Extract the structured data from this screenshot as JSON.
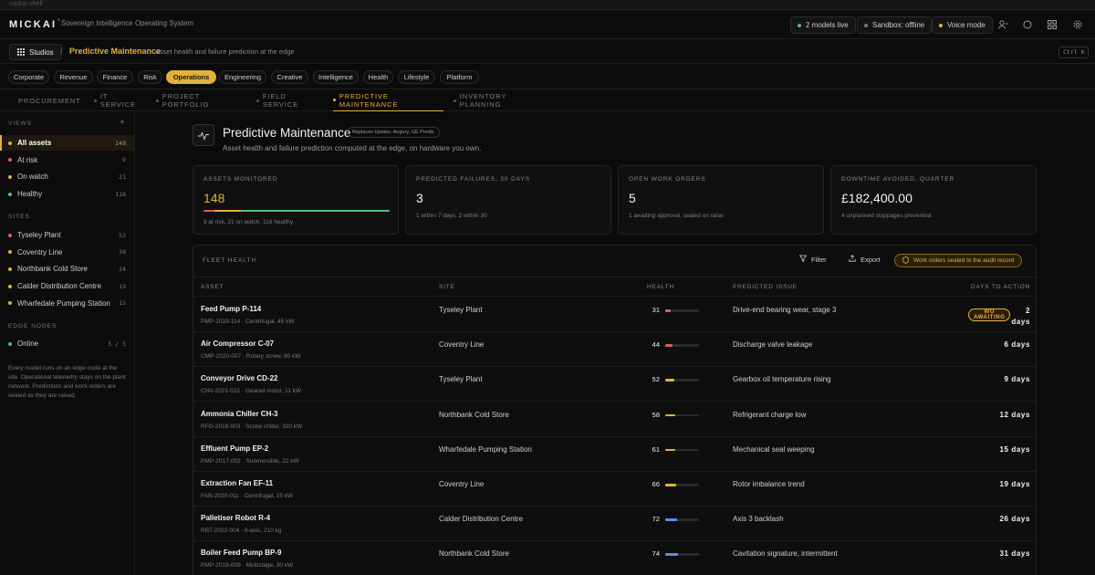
{
  "window": {
    "title": "mickai-shell"
  },
  "topbar": {
    "logo": "MICKAI",
    "logo_mark": "°",
    "tagline": "Sovereign Intelligence Operating System",
    "models_live": "2 models live",
    "sandbox": "Sandbox: offline",
    "voice": "Voice mode",
    "icons": [
      "user-icon",
      "circle-icon",
      "grid-icon",
      "gear-icon"
    ]
  },
  "crumbs": {
    "studios": "Studios",
    "separator": "/",
    "title": "Predictive Maintenance",
    "desc": "Asset health and failure prediction at the edge",
    "shortcut": "Ctrl K"
  },
  "categories": [
    "Corporate",
    "Revenue",
    "Finance",
    "Risk",
    "Operations",
    "Engineering",
    "Creative",
    "Intelligence",
    "Health",
    "Lifestyle",
    "Platform"
  ],
  "active_category": "Operations",
  "subtabs": [
    "Procurement",
    "IT Service",
    "Project Portfolio",
    "Field Service",
    "Predictive Maintenance",
    "Inventory Planning"
  ],
  "active_subtab": "Predictive Maintenance",
  "sidebar": {
    "views_heading": "Views",
    "add": "+",
    "views": [
      {
        "label": "All assets",
        "count": "148",
        "color": "#e2b13c"
      },
      {
        "label": "At risk",
        "count": "9",
        "color": "#e05a5a"
      },
      {
        "label": "On watch",
        "count": "21",
        "color": "#e2b13c"
      },
      {
        "label": "Healthy",
        "count": "118",
        "color": "#4cc27a"
      }
    ],
    "sites_heading": "Sites",
    "sites": [
      {
        "label": "Tyseley Plant",
        "count": "52",
        "color": "#e05a5a"
      },
      {
        "label": "Coventry Line",
        "count": "38",
        "color": "#e2b13c"
      },
      {
        "label": "Northbank Cold Store",
        "count": "24",
        "color": "#e2b13c"
      },
      {
        "label": "Calder Distribution Centre",
        "count": "19",
        "color": "#e2b13c"
      },
      {
        "label": "Wharfedale Pumping Station",
        "count": "15",
        "color": "#e2b13c"
      }
    ],
    "edge_heading": "Edge nodes",
    "edge": {
      "label": "Online",
      "count": "5 / 5",
      "color": "#4cc27a"
    },
    "note": "Every model runs on an edge node at the site. Operational telemetry stays on the plant network. Predictions and work orders are sealed as they are raised."
  },
  "page": {
    "title": "Predictive Maintenance",
    "replaces": "Replaces Uptake, Augury, GE Predix",
    "subtitle": "Asset health and failure prediction computed at the edge, on hardware you own."
  },
  "kpis": [
    {
      "label": "Assets monitored",
      "value": "148",
      "sub": "9 at risk, 21 on watch, 118 healthy",
      "segments": [
        9,
        21,
        118
      ]
    },
    {
      "label": "Predicted failures, 30 days",
      "value": "3",
      "sub": "1 within 7 days, 2 within 30"
    },
    {
      "label": "Open work orders",
      "value": "5",
      "sub": "1 awaiting approval, sealed on raise"
    },
    {
      "label": "Downtime avoided, quarter",
      "value": "£182,400.00",
      "sub": "4 unplanned stoppages prevented"
    }
  ],
  "table": {
    "label": "Fleet health",
    "filter": "Filter",
    "export": "Export",
    "sealed": "Work orders sealed to the audit record",
    "columns": [
      "Asset",
      "Site",
      "Health",
      "Predicted issue",
      "Days to action"
    ],
    "rows": [
      {
        "name": "Feed Pump P-114",
        "meta": "PMP-2019-114 · Centrifugal, 45 kW",
        "site": "Tyseley Plant",
        "health": 31,
        "issue": "Drive-end bearing wear, stage 3",
        "days": "2",
        "unit": "days",
        "badge": [
          "WO",
          "AWAITING"
        ],
        "color": "#e05a5a"
      },
      {
        "name": "Air Compressor C-07",
        "meta": "CMP-2020-007 · Rotary screw, 90 kW",
        "site": "Coventry Line",
        "health": 44,
        "issue": "Discharge valve leakage",
        "days": "6  days",
        "color": "#e05a5a"
      },
      {
        "name": "Conveyor Drive CD-22",
        "meta": "CNV-2021-022 · Geared motor, 11 kW",
        "site": "Tyseley Plant",
        "health": 52,
        "issue": "Gearbox oil temperature rising",
        "days": "9  days",
        "color": "#e2b13c"
      },
      {
        "name": "Ammonia Chiller CH-3",
        "meta": "RFG-2018-003 · Screw chiller, 320 kW",
        "site": "Northbank Cold Store",
        "health": 58,
        "issue": "Refrigerant charge low",
        "days": "12  days",
        "color": "#e2b13c"
      },
      {
        "name": "Effluent Pump EP-2",
        "meta": "PMP-2017-002 · Submersible, 22 kW",
        "site": "Wharfedale Pumping Station",
        "health": 61,
        "issue": "Mechanical seal weeping",
        "days": "15  days",
        "color": "#e2b13c"
      },
      {
        "name": "Extraction Fan EF-11",
        "meta": "FAN-2020-011 · Centrifugal, 15 kW",
        "site": "Coventry Line",
        "health": 66,
        "issue": "Rotor imbalance trend",
        "days": "19  days",
        "color": "#e2b13c"
      },
      {
        "name": "Palletiser Robot R-4",
        "meta": "RBT-2022-004 · 6-axis, 210 kg",
        "site": "Calder Distribution Centre",
        "health": 72,
        "issue": "Axis 3 backlash",
        "days": "26  days",
        "color": "#5b8ee6"
      },
      {
        "name": "Boiler Feed Pump BP-9",
        "meta": "PMP-2019-009 · Multistage, 30 kW",
        "site": "Northbank Cold Store",
        "health": 74,
        "issue": "Cavitation signature, intermittent",
        "days": "31  days",
        "color": "#5b8ee6"
      }
    ]
  },
  "colors": {
    "accent": "#e2b13c",
    "danger": "#e05a5a",
    "ok": "#4cc27a",
    "info": "#5b8ee6"
  }
}
